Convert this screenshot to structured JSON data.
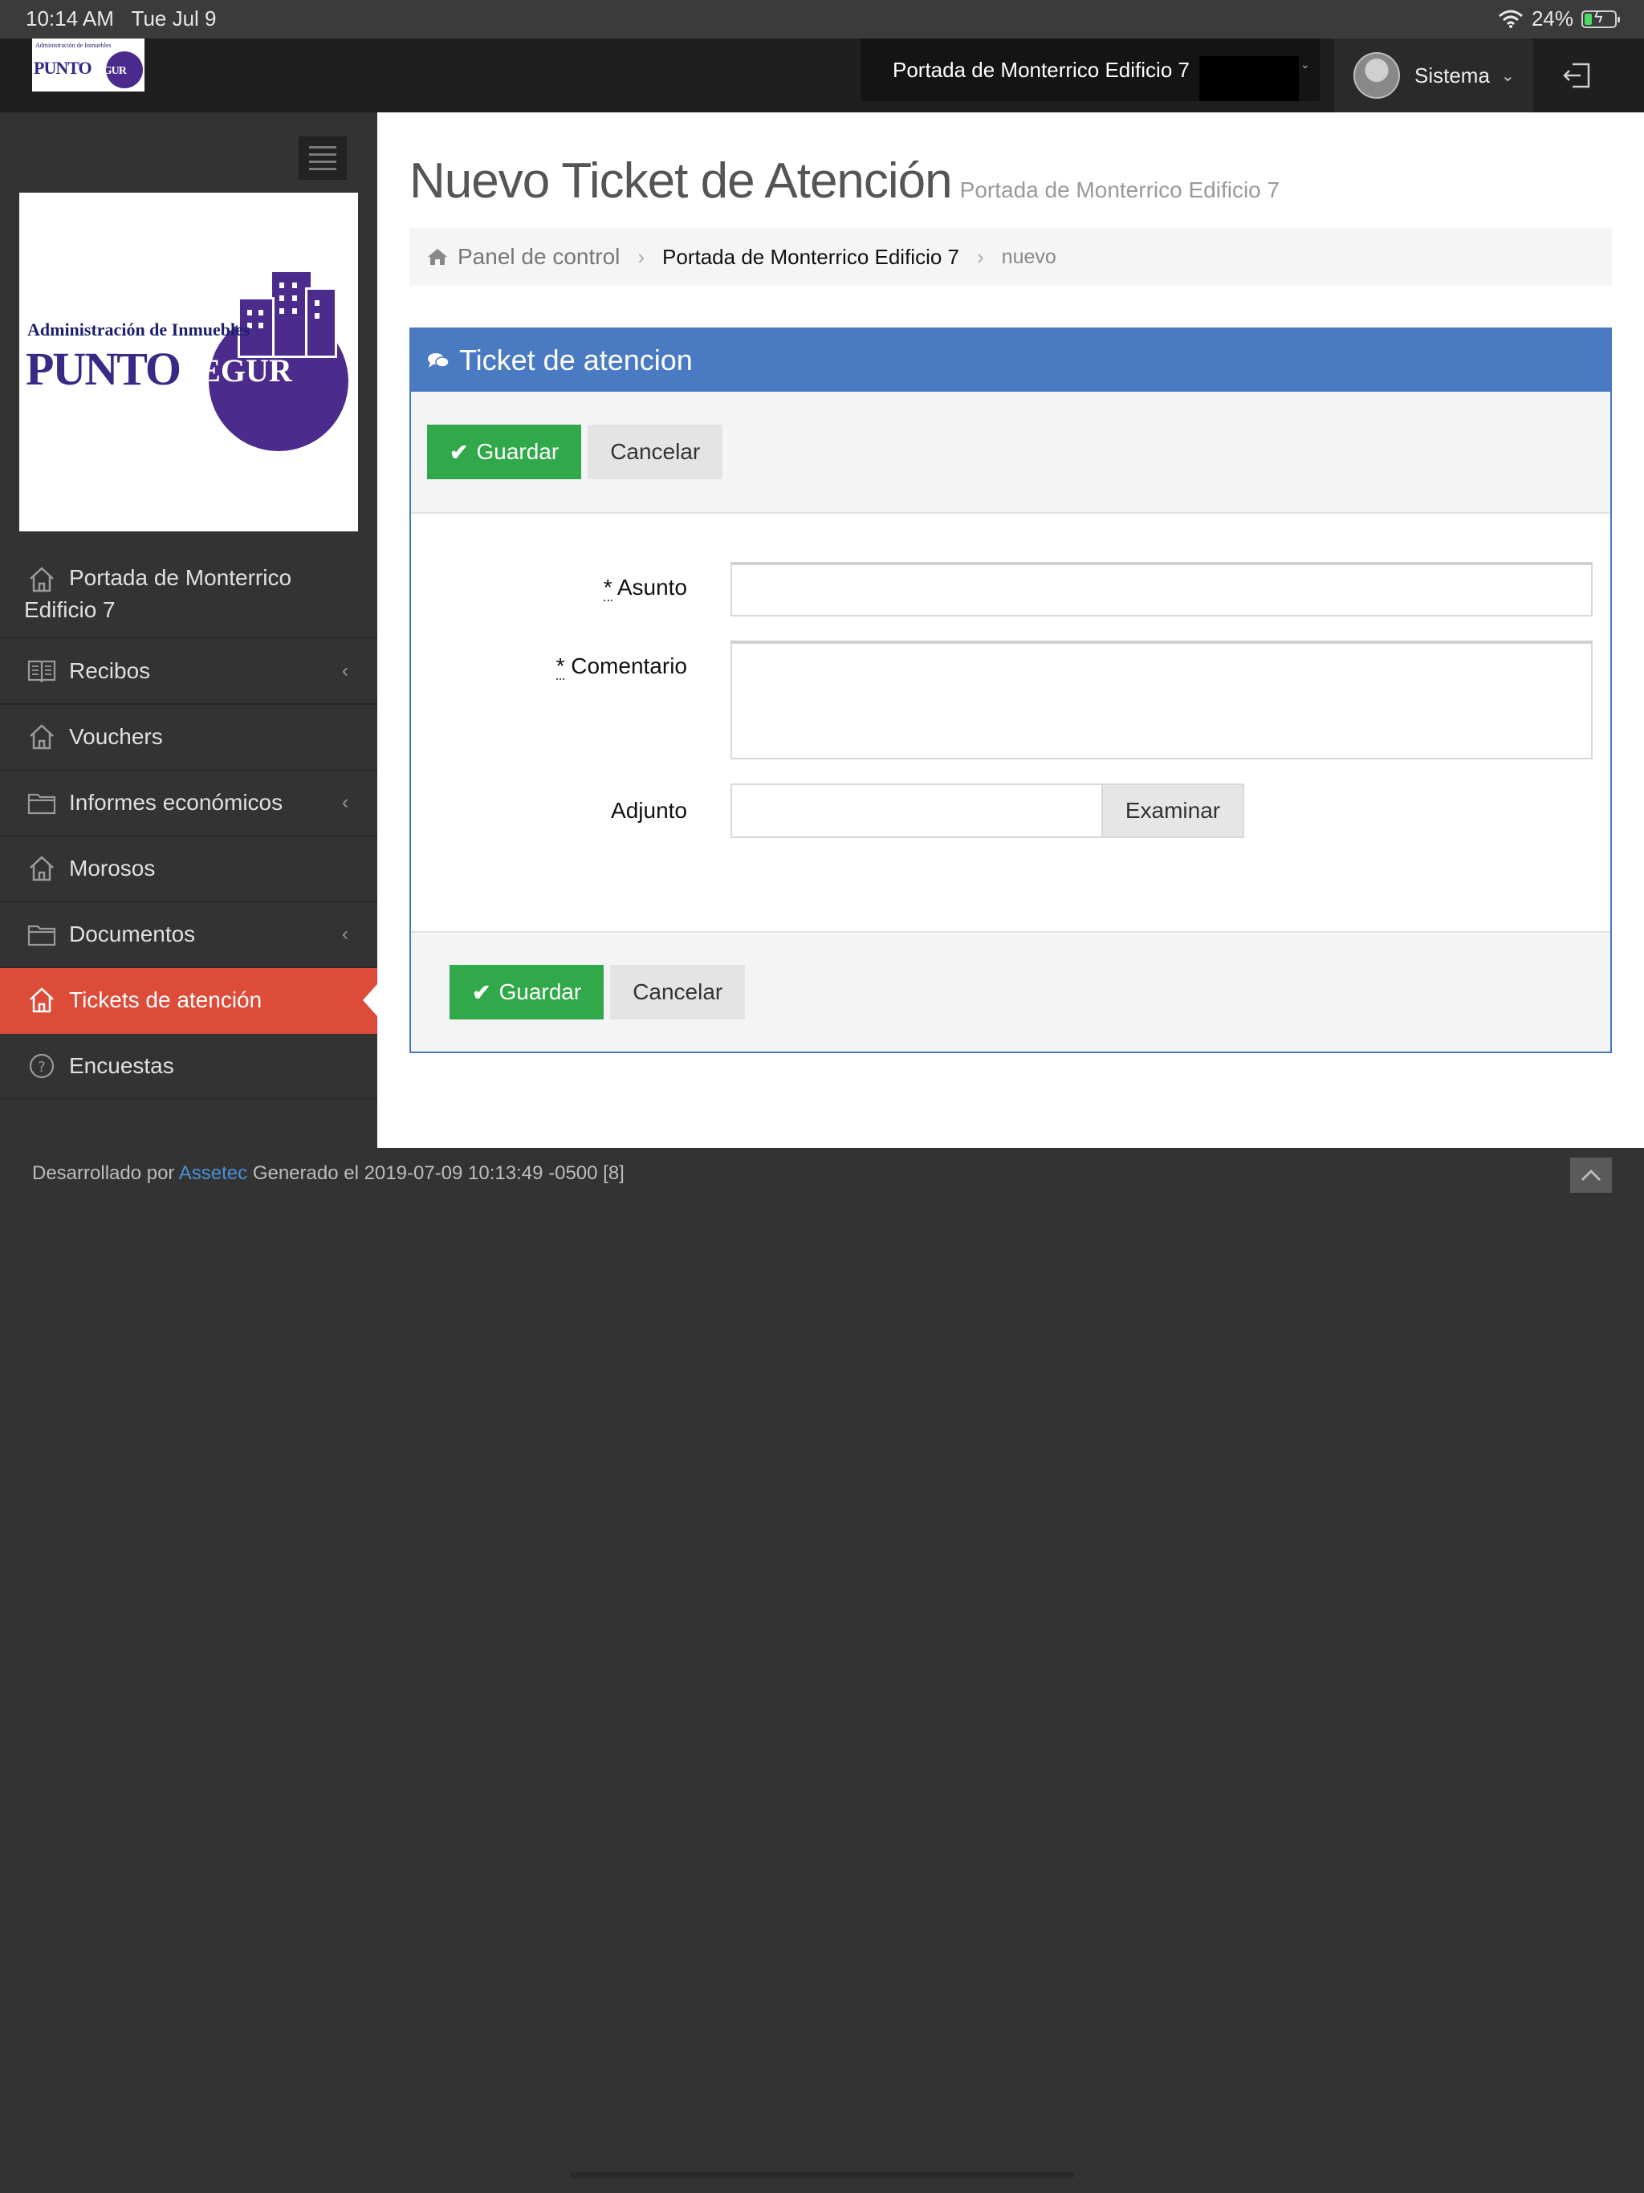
{
  "status_bar": {
    "time": "10:14 AM",
    "date": "Tue Jul 9",
    "battery": "24%"
  },
  "header": {
    "logo_sub": "Administración de Inmuebles",
    "logo_main": "PUNTO",
    "logo_accent": "SEGUR",
    "building": "Portada de Monterrico Edificio 7",
    "user": "Sistema"
  },
  "sidebar": {
    "items": [
      {
        "label": "Portada de Monterrico Edificio 7",
        "icon": "home-icon"
      },
      {
        "label": "Recibos",
        "icon": "book-icon"
      },
      {
        "label": "Vouchers",
        "icon": "home-icon"
      },
      {
        "label": "Informes económicos",
        "icon": "folder-icon"
      },
      {
        "label": "Morosos",
        "icon": "home-icon"
      },
      {
        "label": "Documentos",
        "icon": "folder-icon"
      },
      {
        "label": "Tickets de atención",
        "icon": "home-icon"
      },
      {
        "label": "Encuestas",
        "icon": "question-icon"
      }
    ]
  },
  "page": {
    "title": "Nuevo Ticket de Atención",
    "subtitle": "Portada de Monterrico Edificio 7"
  },
  "breadcrumb": {
    "home": "Panel de control",
    "building": "Portada de Monterrico Edificio 7",
    "current": "nuevo"
  },
  "panel": {
    "title": "Ticket de atencion",
    "save_label": "Guardar",
    "cancel_label": "Cancelar"
  },
  "form": {
    "required_mark": "*",
    "subject_label": "Asunto",
    "subject_value": "",
    "comment_label": "Comentario",
    "comment_value": "",
    "attachment_label": "Adjunto",
    "browse_label": "Examinar"
  },
  "footer": {
    "prefix": "Desarrollado por",
    "link": "Assetec",
    "generated": "Generado el 2019-07-09 10:13:49 -0500 [8]"
  },
  "colors": {
    "active_menu": "#dd4b39",
    "panel_header": "#4a7ac2",
    "save_button": "#31a94a",
    "footer_link": "#4a90d9"
  }
}
